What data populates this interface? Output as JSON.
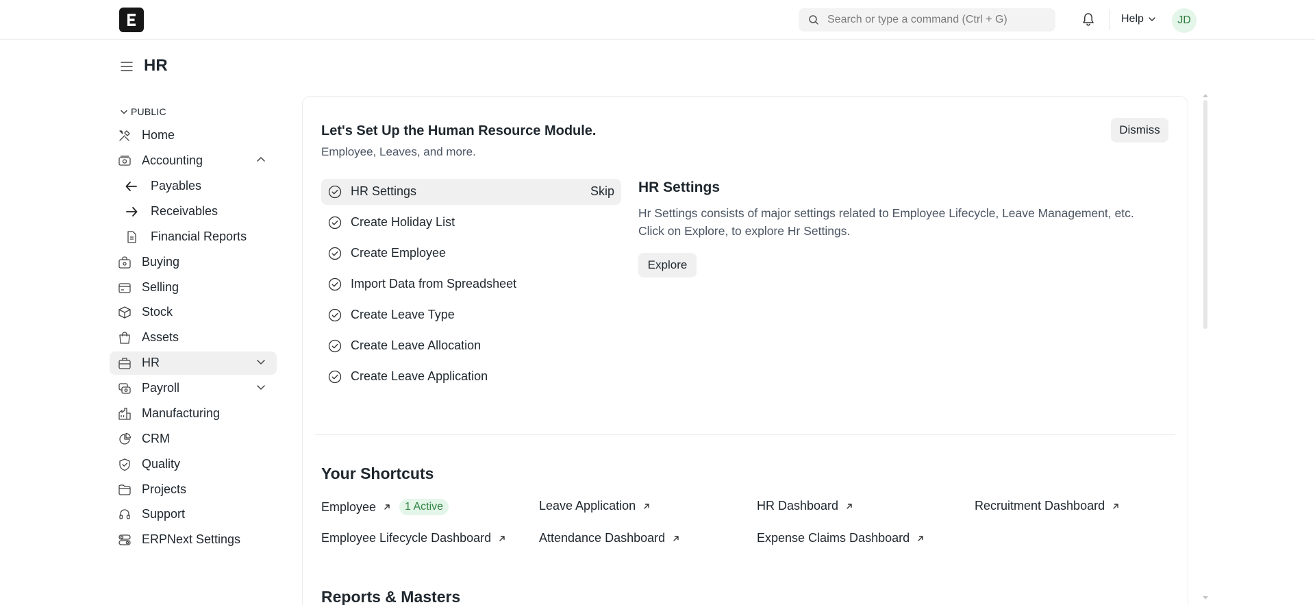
{
  "navbar": {
    "logo_letter": "E",
    "search_placeholder": "Search or type a command (Ctrl + G)",
    "help_label": "Help",
    "avatar_initials": "JD"
  },
  "page": {
    "title": "HR"
  },
  "sidebar": {
    "section_label": "PUBLIC",
    "items": [
      {
        "label": "Home",
        "icon": "tools-icon"
      },
      {
        "label": "Accounting",
        "icon": "accounting-icon",
        "expanded": true
      },
      {
        "label": "Payables",
        "icon": "arrow-left-icon"
      },
      {
        "label": "Receivables",
        "icon": "arrow-right-icon"
      },
      {
        "label": "Financial Reports",
        "icon": "file-icon"
      },
      {
        "label": "Buying",
        "icon": "buying-icon"
      },
      {
        "label": "Selling",
        "icon": "selling-icon"
      },
      {
        "label": "Stock",
        "icon": "stock-icon"
      },
      {
        "label": "Assets",
        "icon": "assets-icon"
      },
      {
        "label": "HR",
        "icon": "hr-icon",
        "active": true
      },
      {
        "label": "Payroll",
        "icon": "payroll-icon"
      },
      {
        "label": "Manufacturing",
        "icon": "manufacturing-icon"
      },
      {
        "label": "CRM",
        "icon": "crm-icon"
      },
      {
        "label": "Quality",
        "icon": "quality-icon"
      },
      {
        "label": "Projects",
        "icon": "projects-icon"
      },
      {
        "label": "Support",
        "icon": "support-icon"
      },
      {
        "label": "ERPNext Settings",
        "icon": "settings-icon"
      }
    ]
  },
  "onboarding": {
    "title": "Let's Set Up the Human Resource Module.",
    "subtitle": "Employee, Leaves, and more.",
    "dismiss_label": "Dismiss",
    "skip_label": "Skip",
    "steps": [
      "HR Settings",
      "Create Holiday List",
      "Create Employee",
      "Import Data from Spreadsheet",
      "Create Leave Type",
      "Create Leave Allocation",
      "Create Leave Application"
    ],
    "detail_title": "HR Settings",
    "detail_text_1": "Hr Settings consists of major settings related to Employee Lifecycle, Leave Management, etc.",
    "detail_text_2": "Click on Explore, to explore Hr Settings.",
    "explore_label": "Explore"
  },
  "shortcuts": {
    "title": "Your Shortcuts",
    "items": [
      {
        "label": "Employee",
        "badge": "1 Active"
      },
      {
        "label": "Leave Application"
      },
      {
        "label": "HR Dashboard"
      },
      {
        "label": "Recruitment Dashboard"
      },
      {
        "label": "Employee Lifecycle Dashboard"
      },
      {
        "label": "Attendance Dashboard"
      },
      {
        "label": "Expense Claims Dashboard"
      }
    ]
  },
  "reports": {
    "title": "Reports & Masters"
  },
  "colors": {
    "active_bg": "#f0f0f0",
    "badge_bg": "#e4f5e9",
    "badge_text": "#2e8540",
    "text": "#1f272e"
  }
}
